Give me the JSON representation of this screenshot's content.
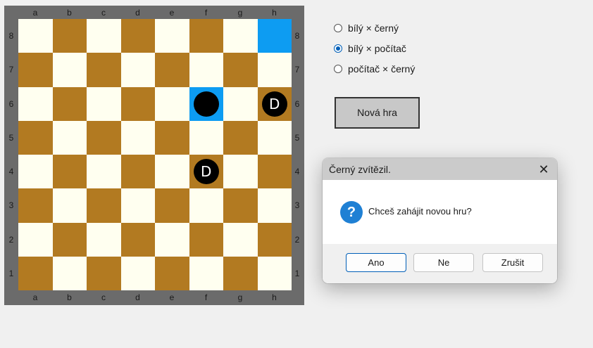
{
  "board": {
    "files": [
      "a",
      "b",
      "c",
      "d",
      "e",
      "f",
      "g",
      "h"
    ],
    "ranks": [
      "8",
      "7",
      "6",
      "5",
      "4",
      "3",
      "2",
      "1"
    ],
    "highlighted": [
      "h8",
      "f6"
    ],
    "pieces": [
      {
        "square": "f6",
        "color": "black",
        "label": ""
      },
      {
        "square": "h6",
        "color": "black",
        "label": "D"
      },
      {
        "square": "f4",
        "color": "black",
        "label": "D"
      }
    ],
    "colors": {
      "light": "#fffff0",
      "dark": "#b27a21",
      "highlight": "#0d9cf2",
      "frame": "#6b6b6b"
    }
  },
  "modes": {
    "options": [
      "bílý × černý",
      "bílý × počítač",
      "počítač × černý"
    ],
    "selected_index": 1
  },
  "new_game_label": "Nová hra",
  "dialog": {
    "title": "Černý zvítězil.",
    "message": "Chceš zahájit novou hru?",
    "icon": "question-icon",
    "buttons": {
      "yes": "Ano",
      "no": "Ne",
      "cancel": "Zrušit"
    }
  }
}
